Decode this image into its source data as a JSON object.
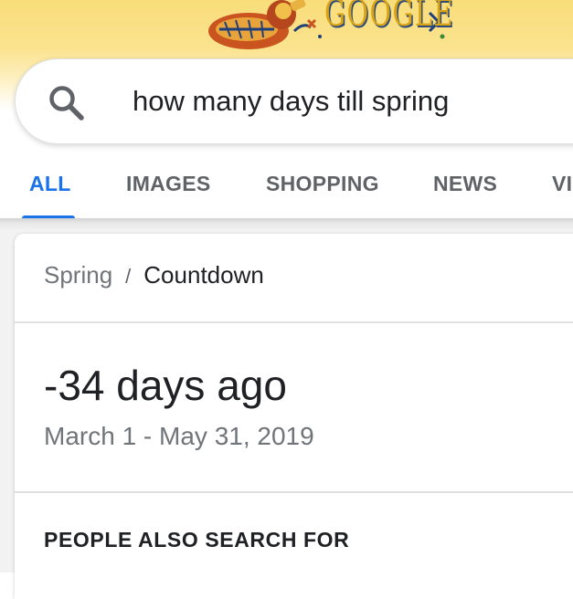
{
  "doodle": {
    "wordmark": "GOOGLE",
    "icon": "google-doodle-icon"
  },
  "search": {
    "query": "how many days till spring",
    "icon": "search-icon"
  },
  "tabs": [
    {
      "label": "ALL",
      "active": true
    },
    {
      "label": "IMAGES",
      "active": false
    },
    {
      "label": "SHOPPING",
      "active": false
    },
    {
      "label": "NEWS",
      "active": false
    },
    {
      "label": "VI",
      "active": false
    }
  ],
  "result": {
    "breadcrumb_parent": "Spring",
    "breadcrumb_separator": "/",
    "breadcrumb_current": "Countdown",
    "answer": "-34 days ago",
    "date_range": "March 1 - May 31, 2019"
  },
  "people_also_search": {
    "heading": "PEOPLE ALSO SEARCH FOR"
  },
  "colors": {
    "accent": "#1a73e8",
    "banner": "#f9dd7a",
    "muted_text": "#70757a"
  }
}
